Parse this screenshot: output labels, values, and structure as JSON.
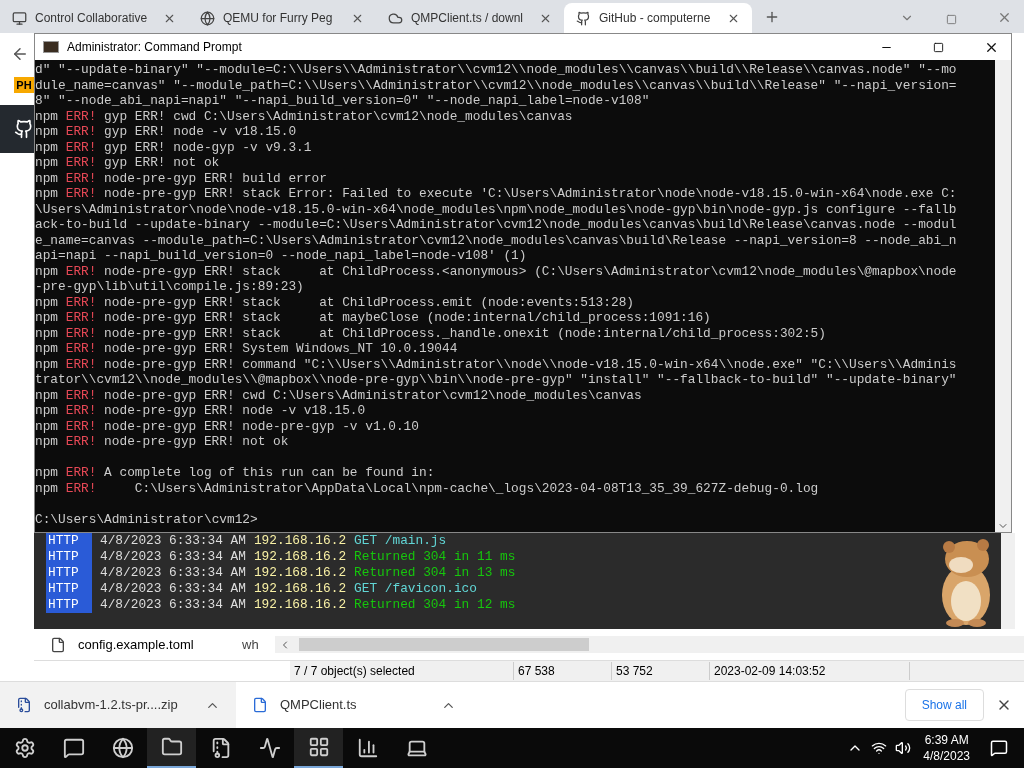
{
  "browser_tabs": [
    {
      "title": "Control Collaborative",
      "selected": false
    },
    {
      "title": "QEMU for Furry Peg",
      "selected": false
    },
    {
      "title": "QMPClient.ts / downl",
      "selected": false
    },
    {
      "title": "GitHub - computerne",
      "selected": true
    }
  ],
  "browser_badge": "PH",
  "console": {
    "title": "Administrator: Command Prompt",
    "lines": [
      {
        "kind": "plain",
        "text": "d\" \"--update-binary\" \"--module=C:\\\\Users\\\\Administrator\\\\cvm12\\\\node_modules\\\\canvas\\\\build\\\\Release\\\\canvas.node\" \"--mo"
      },
      {
        "kind": "plain",
        "text": "dule_name=canvas\" \"--module_path=C:\\\\Users\\\\Administrator\\\\cvm12\\\\node_modules\\\\canvas\\\\build\\\\Release\" \"--napi_version="
      },
      {
        "kind": "plain",
        "text": "8\" \"--node_abi_napi=napi\" \"--napi_build_version=0\" \"--node_napi_label=node-v108\""
      },
      {
        "kind": "err",
        "prefix": "npm",
        "level": "ERR!",
        "text": "gyp ERR! cwd C:\\Users\\Administrator\\cvm12\\node_modules\\canvas"
      },
      {
        "kind": "err",
        "prefix": "npm",
        "level": "ERR!",
        "text": "gyp ERR! node -v v18.15.0"
      },
      {
        "kind": "err",
        "prefix": "npm",
        "level": "ERR!",
        "text": "gyp ERR! node-gyp -v v9.3.1"
      },
      {
        "kind": "err",
        "prefix": "npm",
        "level": "ERR!",
        "text": "gyp ERR! not ok"
      },
      {
        "kind": "err",
        "prefix": "npm",
        "level": "ERR!",
        "text": "node-pre-gyp ERR! build error"
      },
      {
        "kind": "err",
        "prefix": "npm",
        "level": "ERR!",
        "text": "node-pre-gyp ERR! stack Error: Failed to execute 'C:\\Users\\Administrator\\node\\node-v18.15.0-win-x64\\node.exe C:"
      },
      {
        "kind": "plain",
        "text": "\\Users\\Administrator\\node\\node-v18.15.0-win-x64\\node_modules\\npm\\node_modules\\node-gyp\\bin\\node-gyp.js configure --fallb"
      },
      {
        "kind": "plain",
        "text": "ack-to-build --update-binary --module=C:\\Users\\Administrator\\cvm12\\node_modules\\canvas\\build\\Release\\canvas.node --modul"
      },
      {
        "kind": "plain",
        "text": "e_name=canvas --module_path=C:\\Users\\Administrator\\cvm12\\node_modules\\canvas\\build\\Release --napi_version=8 --node_abi_n"
      },
      {
        "kind": "plain",
        "text": "api=napi --napi_build_version=0 --node_napi_label=node-v108' (1)"
      },
      {
        "kind": "err",
        "prefix": "npm",
        "level": "ERR!",
        "text": "node-pre-gyp ERR! stack     at ChildProcess.<anonymous> (C:\\Users\\Administrator\\cvm12\\node_modules\\@mapbox\\node"
      },
      {
        "kind": "plain",
        "text": "-pre-gyp\\lib\\util\\compile.js:89:23)"
      },
      {
        "kind": "err",
        "prefix": "npm",
        "level": "ERR!",
        "text": "node-pre-gyp ERR! stack     at ChildProcess.emit (node:events:513:28)"
      },
      {
        "kind": "err",
        "prefix": "npm",
        "level": "ERR!",
        "text": "node-pre-gyp ERR! stack     at maybeClose (node:internal/child_process:1091:16)"
      },
      {
        "kind": "err",
        "prefix": "npm",
        "level": "ERR!",
        "text": "node-pre-gyp ERR! stack     at ChildProcess._handle.onexit (node:internal/child_process:302:5)"
      },
      {
        "kind": "err",
        "prefix": "npm",
        "level": "ERR!",
        "text": "node-pre-gyp ERR! System Windows_NT 10.0.19044"
      },
      {
        "kind": "err",
        "prefix": "npm",
        "level": "ERR!",
        "text": "node-pre-gyp ERR! command \"C:\\\\Users\\\\Administrator\\\\node\\\\node-v18.15.0-win-x64\\\\node.exe\" \"C:\\\\Users\\\\Adminis"
      },
      {
        "kind": "plain",
        "text": "trator\\\\cvm12\\\\node_modules\\\\@mapbox\\\\node-pre-gyp\\\\bin\\\\node-pre-gyp\" \"install\" \"--fallback-to-build\" \"--update-binary\""
      },
      {
        "kind": "err",
        "prefix": "npm",
        "level": "ERR!",
        "text": "node-pre-gyp ERR! cwd C:\\Users\\Administrator\\cvm12\\node_modules\\canvas"
      },
      {
        "kind": "err",
        "prefix": "npm",
        "level": "ERR!",
        "text": "node-pre-gyp ERR! node -v v18.15.0"
      },
      {
        "kind": "err",
        "prefix": "npm",
        "level": "ERR!",
        "text": "node-pre-gyp ERR! node-pre-gyp -v v1.0.10"
      },
      {
        "kind": "err",
        "prefix": "npm",
        "level": "ERR!",
        "text": "node-pre-gyp ERR! not ok"
      },
      {
        "kind": "blank"
      },
      {
        "kind": "err",
        "prefix": "npm",
        "level": "ERR!",
        "text": "A complete log of this run can be found in:"
      },
      {
        "kind": "err",
        "prefix": "npm",
        "level": "ERR!",
        "text": "    C:\\Users\\Administrator\\AppData\\Local\\npm-cache\\_logs\\2023-04-08T13_35_39_627Z-debug-0.log"
      },
      {
        "kind": "blank"
      },
      {
        "kind": "plain",
        "text": "C:\\Users\\Administrator\\cvm12>"
      }
    ]
  },
  "server_log": [
    {
      "tag": "HTTP",
      "date": "4/8/2023 6:33:34 AM",
      "ip": "192.168.16.2",
      "kind": "get",
      "message": "GET /main.js"
    },
    {
      "tag": "HTTP",
      "date": "4/8/2023 6:33:34 AM",
      "ip": "192.168.16.2",
      "kind": "returned",
      "message": "Returned 304 in 11 ms"
    },
    {
      "tag": "HTTP",
      "date": "4/8/2023 6:33:34 AM",
      "ip": "192.168.16.2",
      "kind": "returned",
      "message": "Returned 304 in 13 ms"
    },
    {
      "tag": "HTTP",
      "date": "4/8/2023 6:33:34 AM",
      "ip": "192.168.16.2",
      "kind": "get",
      "message": "GET /favicon.ico"
    },
    {
      "tag": "HTTP",
      "date": "4/8/2023 6:33:34 AM",
      "ip": "192.168.16.2",
      "kind": "returned",
      "message": "Returned 304 in 12 ms"
    }
  ],
  "explorer": {
    "file": {
      "name": "config.example.toml",
      "column_2": "wh"
    },
    "status_bar": [
      "7 / 7 object(s) selected",
      "67 538",
      "53 752",
      "2023-02-09 14:03:52"
    ]
  },
  "downloads": {
    "items": [
      {
        "name": "collabvm-1.2.ts-pr....zip"
      },
      {
        "name": "QMPClient.ts"
      }
    ],
    "show_all": "Show all"
  },
  "taskbar": {
    "apps": [
      {
        "selected": false
      },
      {
        "selected": false
      },
      {
        "selected": false
      },
      {
        "selected": true
      },
      {
        "selected": false
      },
      {
        "selected": false
      },
      {
        "selected": true
      },
      {
        "selected": false
      },
      {
        "selected": false
      }
    ],
    "time": "6:39 AM",
    "date": "4/8/2023"
  }
}
